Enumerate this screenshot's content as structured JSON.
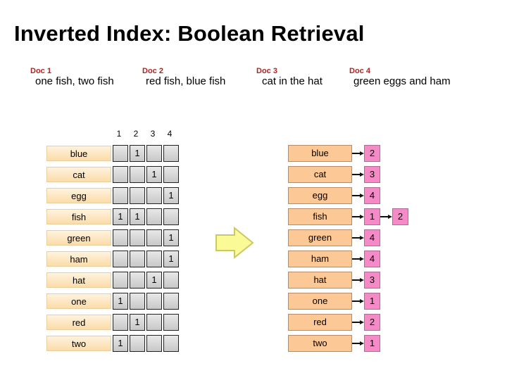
{
  "title": "Inverted Index: Boolean Retrieval",
  "docs": [
    {
      "label": "Doc 1",
      "text": "one fish, two fish"
    },
    {
      "label": "Doc 2",
      "text": "red fish, blue fish"
    },
    {
      "label": "Doc 3",
      "text": "cat in the hat"
    },
    {
      "label": "Doc 4",
      "text": "green eggs and ham"
    }
  ],
  "matrix": {
    "column_headers": [
      "1",
      "2",
      "3",
      "4"
    ],
    "rows": [
      {
        "term": "blue",
        "cells": [
          "",
          "1",
          "",
          ""
        ]
      },
      {
        "term": "cat",
        "cells": [
          "",
          "",
          "1",
          ""
        ]
      },
      {
        "term": "egg",
        "cells": [
          "",
          "",
          "",
          "1"
        ]
      },
      {
        "term": "fish",
        "cells": [
          "1",
          "1",
          "",
          ""
        ]
      },
      {
        "term": "green",
        "cells": [
          "",
          "",
          "",
          "1"
        ]
      },
      {
        "term": "ham",
        "cells": [
          "",
          "",
          "",
          "1"
        ]
      },
      {
        "term": "hat",
        "cells": [
          "",
          "",
          "1",
          ""
        ]
      },
      {
        "term": "one",
        "cells": [
          "1",
          "",
          "",
          ""
        ]
      },
      {
        "term": "red",
        "cells": [
          "",
          "1",
          "",
          ""
        ]
      },
      {
        "term": "two",
        "cells": [
          "1",
          "",
          "",
          ""
        ]
      }
    ]
  },
  "postings": [
    {
      "term": "blue",
      "docs": [
        "2"
      ]
    },
    {
      "term": "cat",
      "docs": [
        "3"
      ]
    },
    {
      "term": "egg",
      "docs": [
        "4"
      ]
    },
    {
      "term": "fish",
      "docs": [
        "1",
        "2"
      ]
    },
    {
      "term": "green",
      "docs": [
        "4"
      ]
    },
    {
      "term": "ham",
      "docs": [
        "4"
      ]
    },
    {
      "term": "hat",
      "docs": [
        "3"
      ]
    },
    {
      "term": "one",
      "docs": [
        "1"
      ]
    },
    {
      "term": "red",
      "docs": [
        "2"
      ]
    },
    {
      "term": "two",
      "docs": [
        "1"
      ]
    }
  ],
  "colors": {
    "doc_label": "#b22222",
    "term_box": "#fbc896",
    "posting_box": "#f48ac6",
    "arrow_fill": "#fafa96"
  }
}
